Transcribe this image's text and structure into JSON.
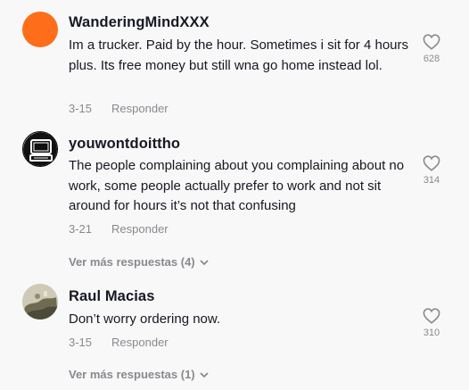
{
  "comments": [
    {
      "username": "WanderingMindXXX",
      "text": "Im a trucker. Paid by the hour. Sometimes i sit for 4 hours plus. Its free money but still wna go home instead lol.",
      "date": "3-15",
      "reply_label": "Responder",
      "likes": "628",
      "avatar": "orange-circle"
    },
    {
      "username": "youwontdoittho",
      "text": "The people complaining about you complaining about no work, some people actually prefer to work and not sit around for hours it’s not that confusing",
      "date": "3-21",
      "reply_label": "Responder",
      "likes": "314",
      "avatar": "computer-sketch",
      "more_replies": "Ver más respuestas (4)"
    },
    {
      "username": "Raul Macias",
      "text": "Don’t worry ordering now.",
      "date": "3-15",
      "reply_label": "Responder",
      "likes": "310",
      "avatar": "photo",
      "more_replies": "Ver más respuestas (1)"
    }
  ],
  "icons": {
    "like": "heart-outline-icon",
    "expand": "chevron-down-icon"
  },
  "colors": {
    "orange_avatar": "#fe6d1a",
    "text": "#161823",
    "muted": "#8a8b91"
  }
}
